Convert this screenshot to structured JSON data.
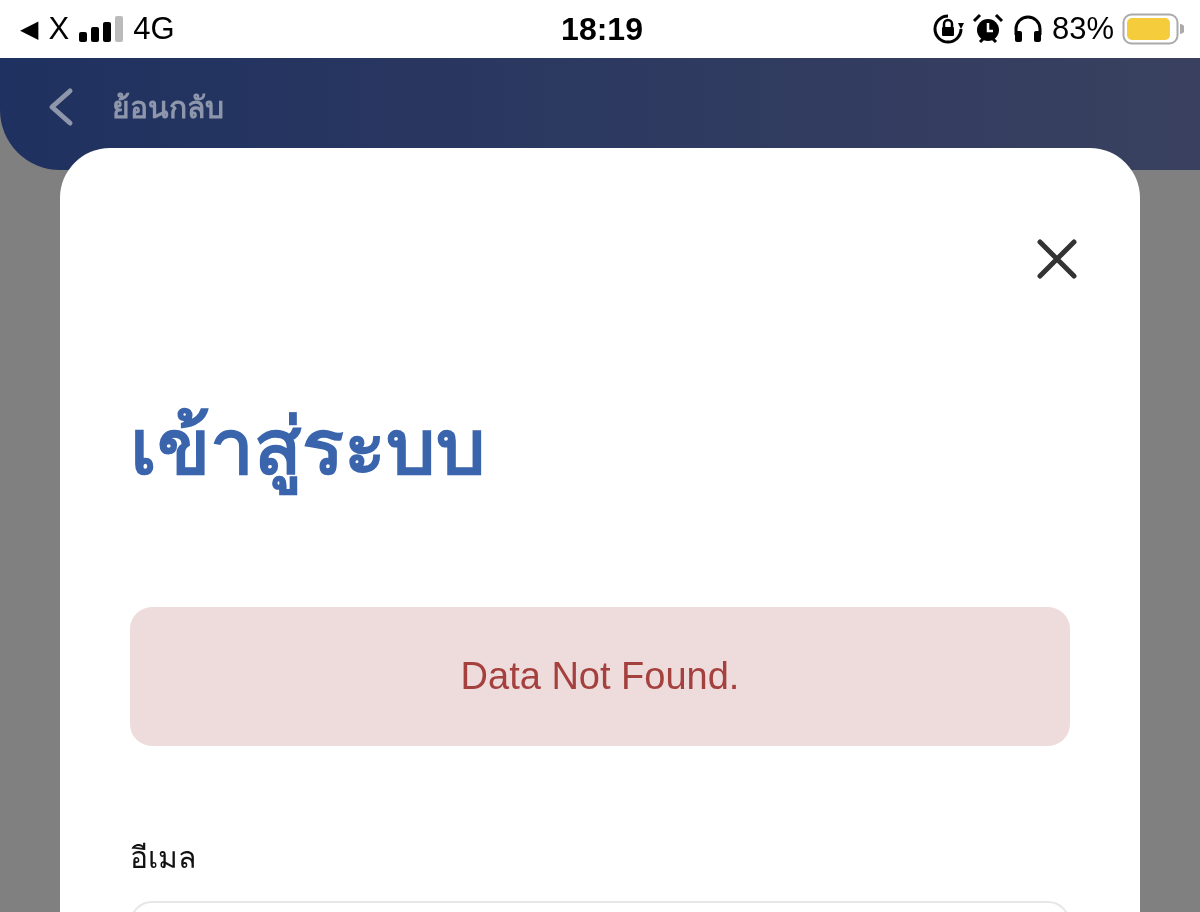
{
  "status_bar": {
    "back_glyph": "◀",
    "back_app": "X",
    "network": "4G",
    "time": "18:19",
    "battery_percent": "83%"
  },
  "header": {
    "back_label": "ย้อนกลับ"
  },
  "modal": {
    "title": "เข้าสู่ระบบ",
    "error": "Data Not Found.",
    "fields": [
      {
        "label": "อีเมล"
      }
    ]
  }
}
